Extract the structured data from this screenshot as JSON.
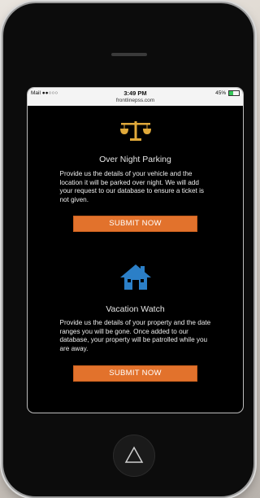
{
  "status_bar": {
    "carrier": "Mail ●●○○○",
    "time": "3:49 PM",
    "url": "frontlinepss.com",
    "battery": "45%",
    "battery_level": 0.45
  },
  "sections": [
    {
      "icon": "scales-icon",
      "title": "Over Night Parking",
      "description": "Provide us the details of your vehicle and the location it will be parked over night. We will add your request to our database to ensure a ticket is not given.",
      "button_label": "SUBMIT NOW"
    },
    {
      "icon": "house-icon",
      "title": "Vacation Watch",
      "description": "Provide us the details of your property and the date ranges you will be gone. Once added to our database, your property will be patrolled while you are away.",
      "button_label": "SUBMIT NOW"
    }
  ],
  "colors": {
    "accent": "#e2722c",
    "icon_gold": "#e0a93a",
    "icon_blue": "#2b7fc7"
  },
  "home_button_icon": "triangle-icon"
}
